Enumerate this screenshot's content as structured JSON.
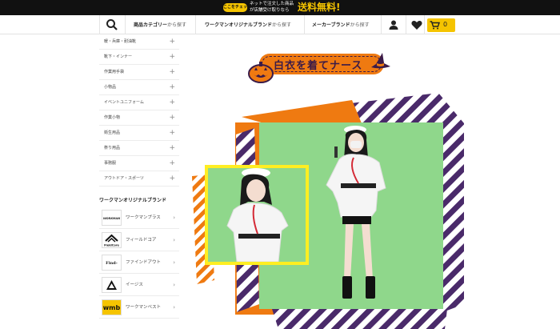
{
  "topbar": {
    "check_label": "ここをチェック!",
    "message": "ネットで注文した商品が店舗受け取りなら",
    "free_label": "送料無料!"
  },
  "nav": {
    "category_bold": "商品カテゴリー",
    "category_rest": "から探す",
    "brand_bold": "ワークマンオリジナルブランド",
    "brand_rest": "から探す",
    "maker_bold": "メーカーブランド",
    "maker_rest": "から探す",
    "cart_count": "0"
  },
  "sidebar": {
    "categories": [
      "暖・兵庫・耐油靴",
      "靴下・インナー",
      "作業用手袋",
      "小物品",
      "イベントユニフォーム",
      "作業小物",
      "衛生用品",
      "祭り用品",
      "事務服",
      "アウトドア・スポーツ"
    ],
    "brands_heading": "ワークマンオリジナルブランド",
    "brands": [
      {
        "logo": "WORKMAN PLUS",
        "name": "ワークマンプラス"
      },
      {
        "logo": "FieldCore",
        "name": "フィールドコア"
      },
      {
        "logo": "Find-Out",
        "name": "ファインドアウト"
      },
      {
        "logo": "AEGIS",
        "name": "イージス"
      },
      {
        "logo": "wmb",
        "name": "ワークマンベスト"
      }
    ]
  },
  "hero": {
    "banner_text": "白衣を着てナース"
  },
  "colors": {
    "accent_yellow": "#f5c400",
    "orange": "#ef7a11",
    "purple": "#3b1b48",
    "green": "#8fd78b"
  }
}
